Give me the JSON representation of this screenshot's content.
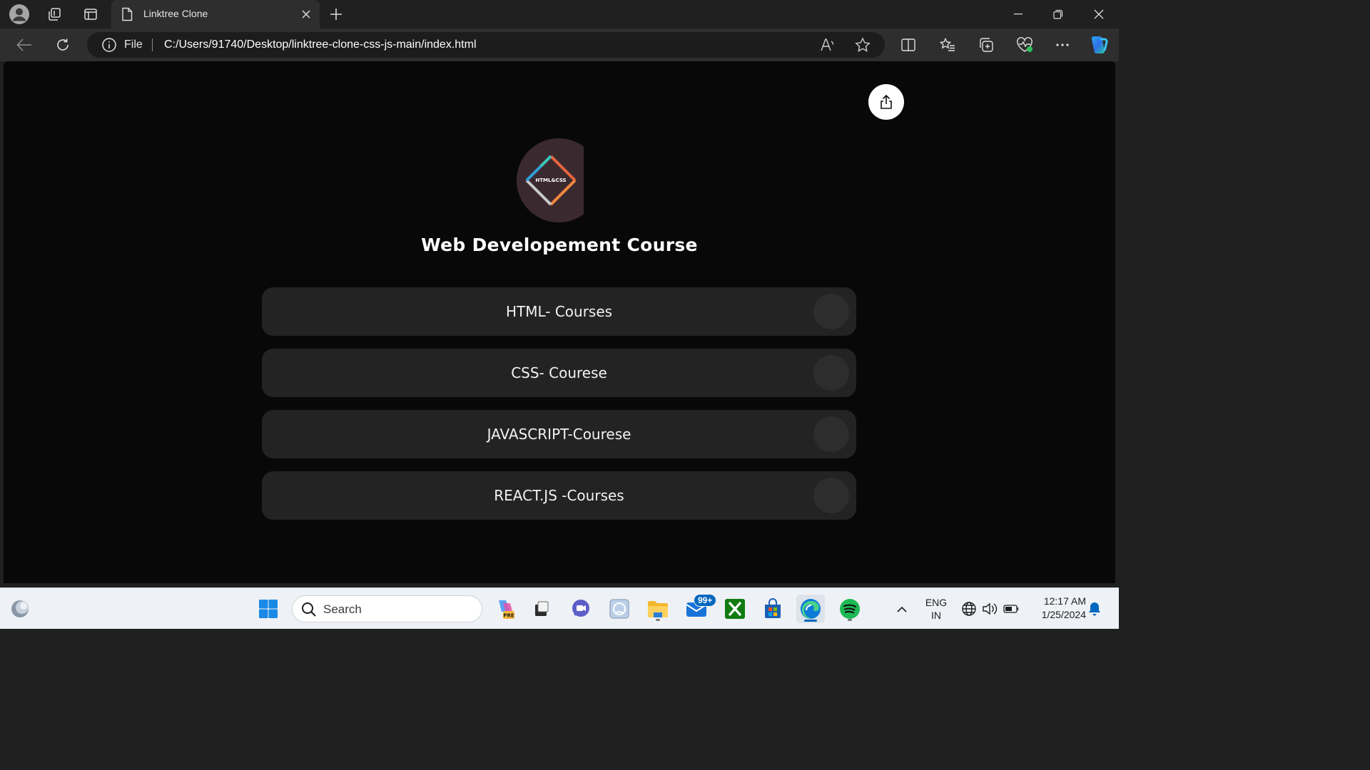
{
  "browser": {
    "tab": {
      "title": "Linktree Clone",
      "icon": "page-icon"
    },
    "address": {
      "scheme_label": "File",
      "url": "C:/Users/91740/Desktop/linktree-clone-css-js-main/index.html"
    }
  },
  "page": {
    "heading": "Web Developement Course",
    "logo_text": "HTML&CSS",
    "links": [
      {
        "label": "HTML- Courses"
      },
      {
        "label": "CSS- Courese"
      },
      {
        "label": "JAVASCRIPT-Courese"
      },
      {
        "label": "REACT.JS -Courses"
      }
    ]
  },
  "taskbar": {
    "search_label": "Search",
    "mail_badge": "99+",
    "language": {
      "line1": "ENG",
      "line2": "IN"
    },
    "clock": {
      "time": "12:17 AM",
      "date": "1/25/2024"
    }
  },
  "colors": {
    "page_bg": "#080808",
    "card_bg": "#232323",
    "accent": "#0067c0"
  }
}
